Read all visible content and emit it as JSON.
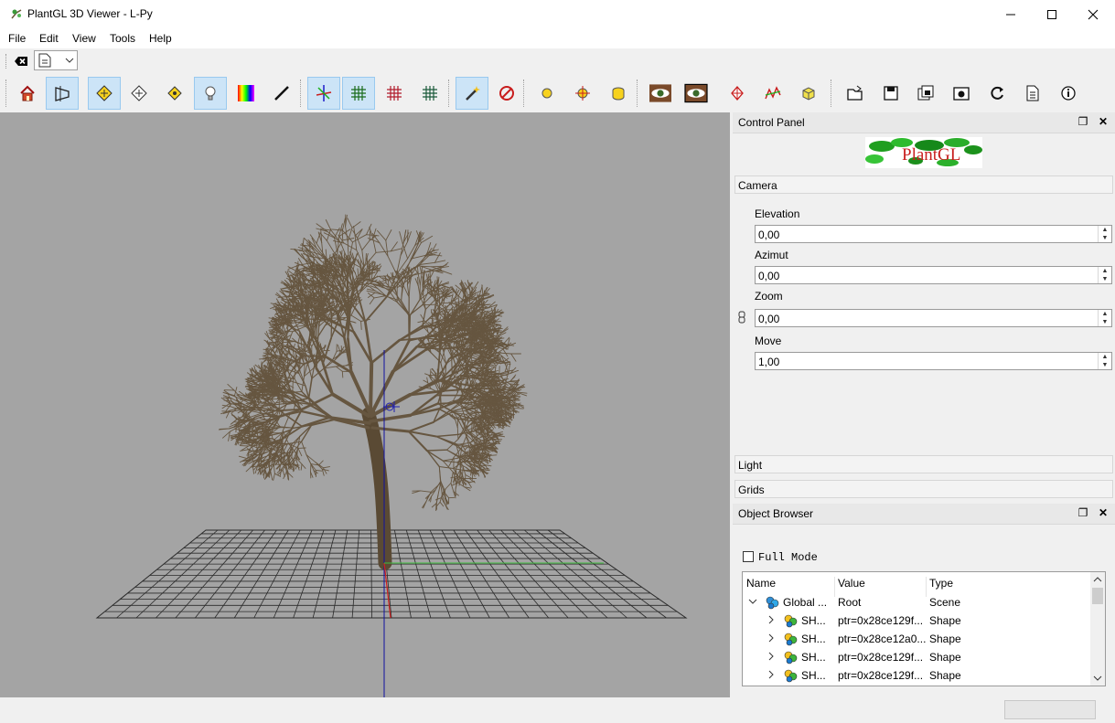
{
  "window": {
    "title": "PlantGL 3D Viewer - L-Py"
  },
  "menu": [
    "File",
    "Edit",
    "View",
    "Tools",
    "Help"
  ],
  "toolbar": {
    "items": [
      {
        "icon": "home-icon",
        "on": false
      },
      {
        "icon": "perspective-icon",
        "on": true
      },
      {
        "icon": "rotate-mode-icon",
        "on": true
      },
      {
        "icon": "move-mode-icon",
        "on": false
      },
      {
        "icon": "zoom-mode-icon",
        "on": false
      },
      {
        "icon": "light-bulb-icon",
        "on": true
      },
      {
        "icon": "color-palette-icon",
        "on": false
      },
      {
        "icon": "line-width-icon",
        "on": false
      },
      {
        "icon": "axes-icon",
        "on": true
      },
      {
        "icon": "xy-grid-icon",
        "on": true
      },
      {
        "icon": "xz-grid-icon",
        "on": false
      },
      {
        "icon": "yz-grid-icon",
        "on": false
      },
      {
        "icon": "magic-wand-icon",
        "on": true
      },
      {
        "icon": "clip-plane-icon",
        "on": false
      },
      {
        "icon": "sphere-icon",
        "on": false
      },
      {
        "icon": "crosshair-icon",
        "on": false
      },
      {
        "icon": "cylinder-icon",
        "on": false
      },
      {
        "icon": "eye-stereo-icon",
        "on": false
      },
      {
        "icon": "eye-camera-icon",
        "on": false
      },
      {
        "icon": "frame-icon",
        "on": false
      },
      {
        "icon": "curve-icon",
        "on": false
      },
      {
        "icon": "box-icon",
        "on": false
      },
      {
        "icon": "open-file-icon",
        "on": false
      },
      {
        "icon": "save-icon",
        "on": false
      },
      {
        "icon": "save-multiple-icon",
        "on": false
      },
      {
        "icon": "screenshot-icon",
        "on": false
      },
      {
        "icon": "refresh-icon",
        "on": false
      },
      {
        "icon": "document-icon",
        "on": false
      },
      {
        "icon": "info-icon",
        "on": false
      }
    ]
  },
  "control_panel": {
    "title": "Control Panel",
    "logo_text": "PlantGL",
    "camera": {
      "label": "Camera",
      "fields": [
        {
          "label": "Elevation",
          "value": "0,00"
        },
        {
          "label": "Azimut",
          "value": "0,00"
        },
        {
          "label": "Zoom",
          "value": "0,00"
        },
        {
          "label": "Move",
          "value": "1,00"
        }
      ]
    },
    "light_label": "Light",
    "grids_label": "Grids"
  },
  "object_browser": {
    "title": "Object Browser",
    "full_mode_label": "Full Mode",
    "columns": [
      "Name",
      "Value",
      "Type"
    ],
    "rows": [
      {
        "name": "Global ...",
        "value": "Root",
        "type": "Scene"
      },
      {
        "name": "SH...",
        "value": "ptr=0x28ce129f...",
        "type": "Shape"
      },
      {
        "name": "SH...",
        "value": "ptr=0x28ce12a0...",
        "type": "Shape"
      },
      {
        "name": "SH...",
        "value": "ptr=0x28ce129f...",
        "type": "Shape"
      },
      {
        "name": "SH...",
        "value": "ptr=0x28ce129f...",
        "type": "Shape"
      }
    ]
  },
  "colors": {
    "viewport_bg": "#a4a4a4",
    "branch": "#665640",
    "trunk": "#5a4a34",
    "selected_bg": "#cce4f7"
  }
}
